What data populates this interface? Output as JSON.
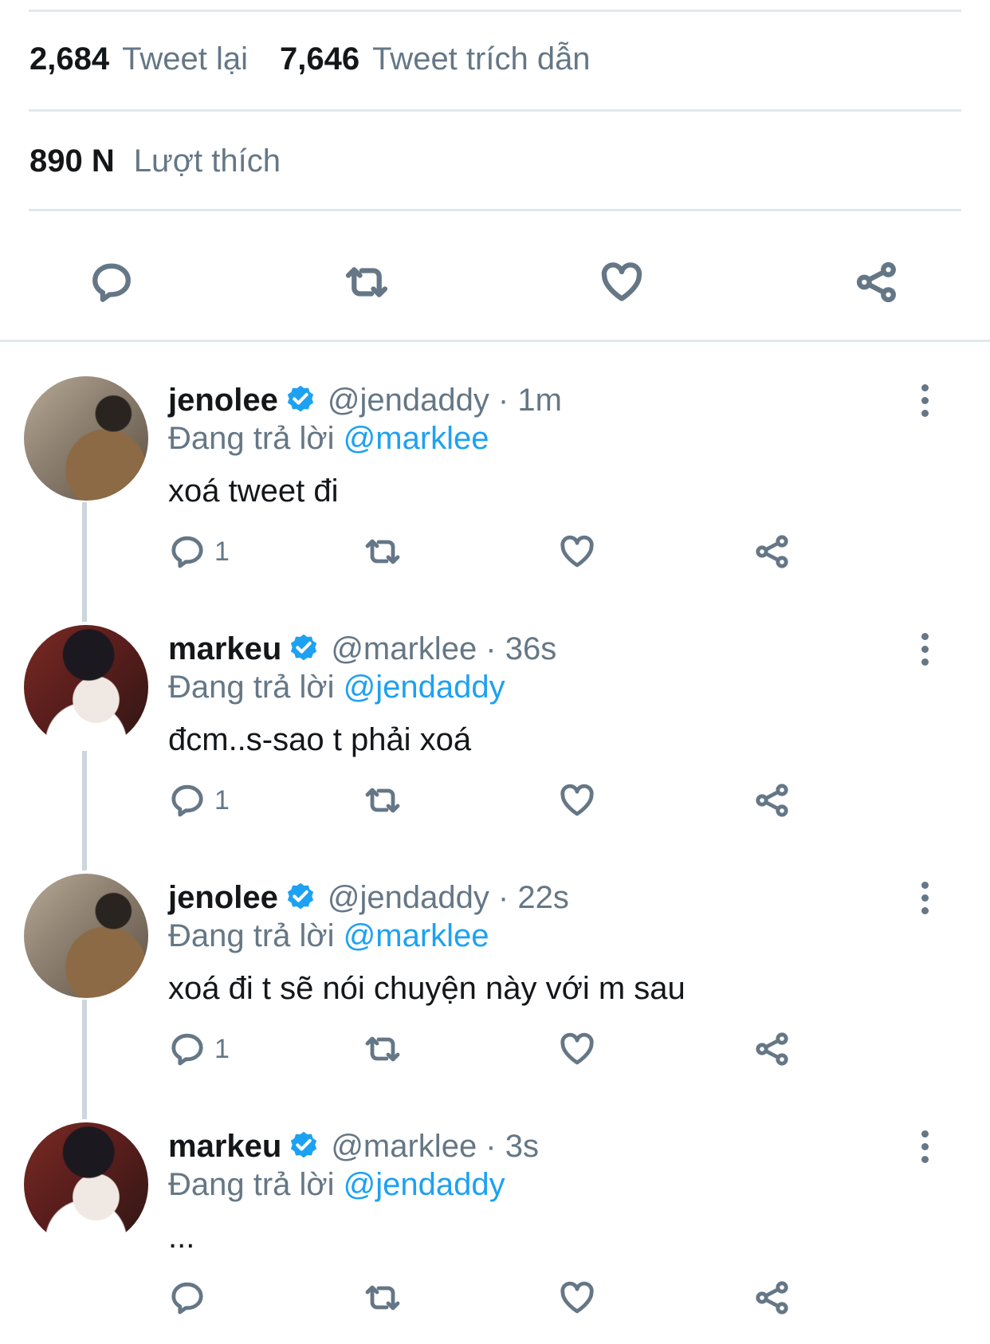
{
  "stats": {
    "retweets_count": "2,684",
    "retweets_label": "Tweet lại",
    "quotes_count": "7,646",
    "quotes_label": "Tweet trích dẫn",
    "likes_count": "890 N",
    "likes_label": "Lượt thích"
  },
  "main_actions": [
    "reply-icon",
    "retweet-icon",
    "like-icon",
    "share-icon"
  ],
  "colors": {
    "link": "#1da1f2",
    "muted": "#657786",
    "verified": "#1da1f2",
    "divider": "#e1e8ed"
  },
  "replying_prefix": "Đang trả lời",
  "replies": [
    {
      "name": "jenolee",
      "handle": "@jendaddy · 1m",
      "reply_to": "@marklee",
      "text": "xoá tweet đi",
      "reply_count": "1"
    },
    {
      "name": "markeu",
      "handle": "@marklee · 36s",
      "reply_to": "@jendaddy",
      "text": "đcm..s-sao t phải xoá",
      "reply_count": "1"
    },
    {
      "name": "jenolee",
      "handle": "@jendaddy · 22s",
      "reply_to": "@marklee",
      "text": "xoá đi t sẽ nói chuyện này với m sau",
      "reply_count": "1"
    },
    {
      "name": "markeu",
      "handle": "@marklee · 3s",
      "reply_to": "@jendaddy",
      "text": "...",
      "reply_count": ""
    }
  ]
}
